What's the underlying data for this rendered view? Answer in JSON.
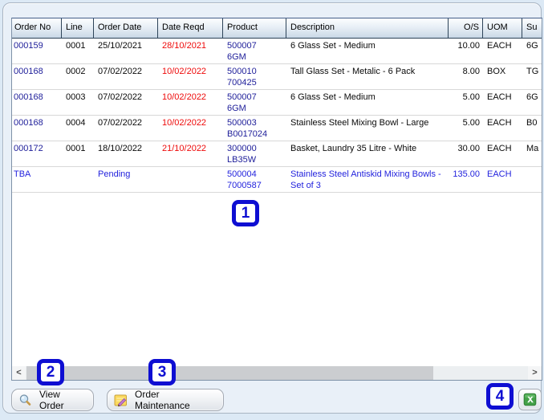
{
  "table": {
    "columns": [
      {
        "key": "order_no",
        "label": "Order No"
      },
      {
        "key": "line",
        "label": "Line"
      },
      {
        "key": "order_date",
        "label": "Order Date"
      },
      {
        "key": "date_reqd",
        "label": "Date Reqd"
      },
      {
        "key": "product",
        "label": "Product"
      },
      {
        "key": "description",
        "label": "Description"
      },
      {
        "key": "os",
        "label": "O/S"
      },
      {
        "key": "uom",
        "label": "UOM"
      },
      {
        "key": "su",
        "label": "Su"
      }
    ],
    "rows": [
      {
        "order_no": "000159",
        "line": "0001",
        "order_date": "25/10/2021",
        "date_reqd": "28/10/2021",
        "product_line1": "500007",
        "product_line2": "6GM",
        "description": "6 Glass Set - Medium",
        "os": "10.00",
        "uom": "EACH",
        "su": "6G",
        "pending": false
      },
      {
        "order_no": "000168",
        "line": "0002",
        "order_date": "07/02/2022",
        "date_reqd": "10/02/2022",
        "product_line1": "500010",
        "product_line2": "700425",
        "description": "Tall Glass Set - Metalic - 6 Pack",
        "os": "8.00",
        "uom": "BOX",
        "su": "TG",
        "pending": false
      },
      {
        "order_no": "000168",
        "line": "0003",
        "order_date": "07/02/2022",
        "date_reqd": "10/02/2022",
        "product_line1": "500007",
        "product_line2": "6GM",
        "description": "6 Glass Set - Medium",
        "os": "5.00",
        "uom": "EACH",
        "su": "6G",
        "pending": false
      },
      {
        "order_no": "000168",
        "line": "0004",
        "order_date": "07/02/2022",
        "date_reqd": "10/02/2022",
        "product_line1": "500003",
        "product_line2": "B0017024",
        "description": "Stainless Steel Mixing Bowl - Large",
        "os": "5.00",
        "uom": "EACH",
        "su": "B0",
        "pending": false
      },
      {
        "order_no": "000172",
        "line": "0001",
        "order_date": "18/10/2022",
        "date_reqd": "21/10/2022",
        "product_line1": "300000",
        "product_line2": "LB35W",
        "description": "Basket, Laundry 35 Litre - White",
        "os": "30.00",
        "uom": "EACH",
        "su": "Ma",
        "pending": false
      },
      {
        "order_no": "TBA",
        "line": "",
        "order_date": "Pending",
        "date_reqd": "",
        "product_line1": "500004",
        "product_line2": "7000587",
        "description": "Stainless Steel Antiskid Mixing Bowls - Set of 3",
        "os": "135.00",
        "uom": "EACH",
        "su": "",
        "pending": true
      }
    ]
  },
  "scrollbar": {
    "left_arrow": "<",
    "right_arrow": ">"
  },
  "buttons": {
    "view_order": "View Order",
    "order_maintenance": "Order Maintenance"
  },
  "icons": {
    "view_order": "magnifier-icon",
    "order_maintenance": "note-edit-icon",
    "excel": "excel-export-icon"
  },
  "annotations": [
    {
      "label": "1"
    },
    {
      "label": "2"
    },
    {
      "label": "3"
    },
    {
      "label": "4"
    }
  ],
  "colors": {
    "order_link_navy": "#1d1d99",
    "pending_blue": "#2323dd",
    "overdue_red": "#ee0a0a",
    "annotation_blue": "#0e0ed2",
    "excel_green": "#43a047",
    "header_gradient_bottom": "#c9d8e6"
  }
}
